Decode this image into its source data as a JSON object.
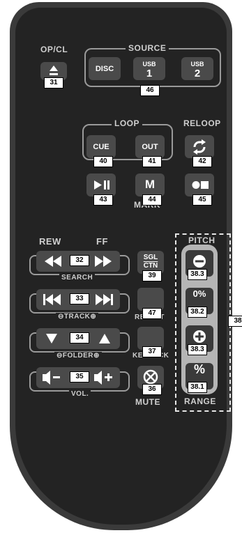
{
  "labels": {
    "opcl": "OP/CL",
    "source": "SOURCE",
    "loop": "LOOP",
    "reloop": "RELOOP",
    "mark": "MARK",
    "rew": "REW",
    "ff": "FF",
    "search": "SEARCH",
    "track": "TRACK",
    "folder": "FOLDER",
    "vol": "VOL.",
    "repeat": "REPEAT",
    "keylock": "KEYLOCK",
    "mute": "MUTE",
    "pitch": "PITCH",
    "range": "RANGE"
  },
  "buttons": {
    "disc": "DISC",
    "usb1_top": "USB",
    "usb1_num": "1",
    "usb2_top": "USB",
    "usb2_num": "2",
    "cue": "CUE",
    "out": "OUT",
    "m": "M",
    "sgl": "SGL",
    "ctn": "CTN",
    "zero_pct": "0%",
    "pct": "%"
  },
  "callouts": {
    "opcl": "31",
    "source": "46",
    "cue": "40",
    "out": "41",
    "reloop": "42",
    "play_pause": "43",
    "mark": "44",
    "rec": "45",
    "search": "32",
    "sgl_ctn": "39",
    "track": "33",
    "repeat": "47",
    "folder": "34",
    "keylock": "37",
    "vol": "35",
    "mute": "36",
    "pitch_minus": "38.3",
    "pitch_zero": "38.2",
    "pitch_plus": "38.3",
    "range": "38.1",
    "pitch_group": "38"
  },
  "colors": {
    "body": "#232323",
    "rim": "#3a3a3a",
    "button": "#4a4a4a",
    "label": "#cfcfcf",
    "pitch_strip": "#b5b5b5"
  }
}
